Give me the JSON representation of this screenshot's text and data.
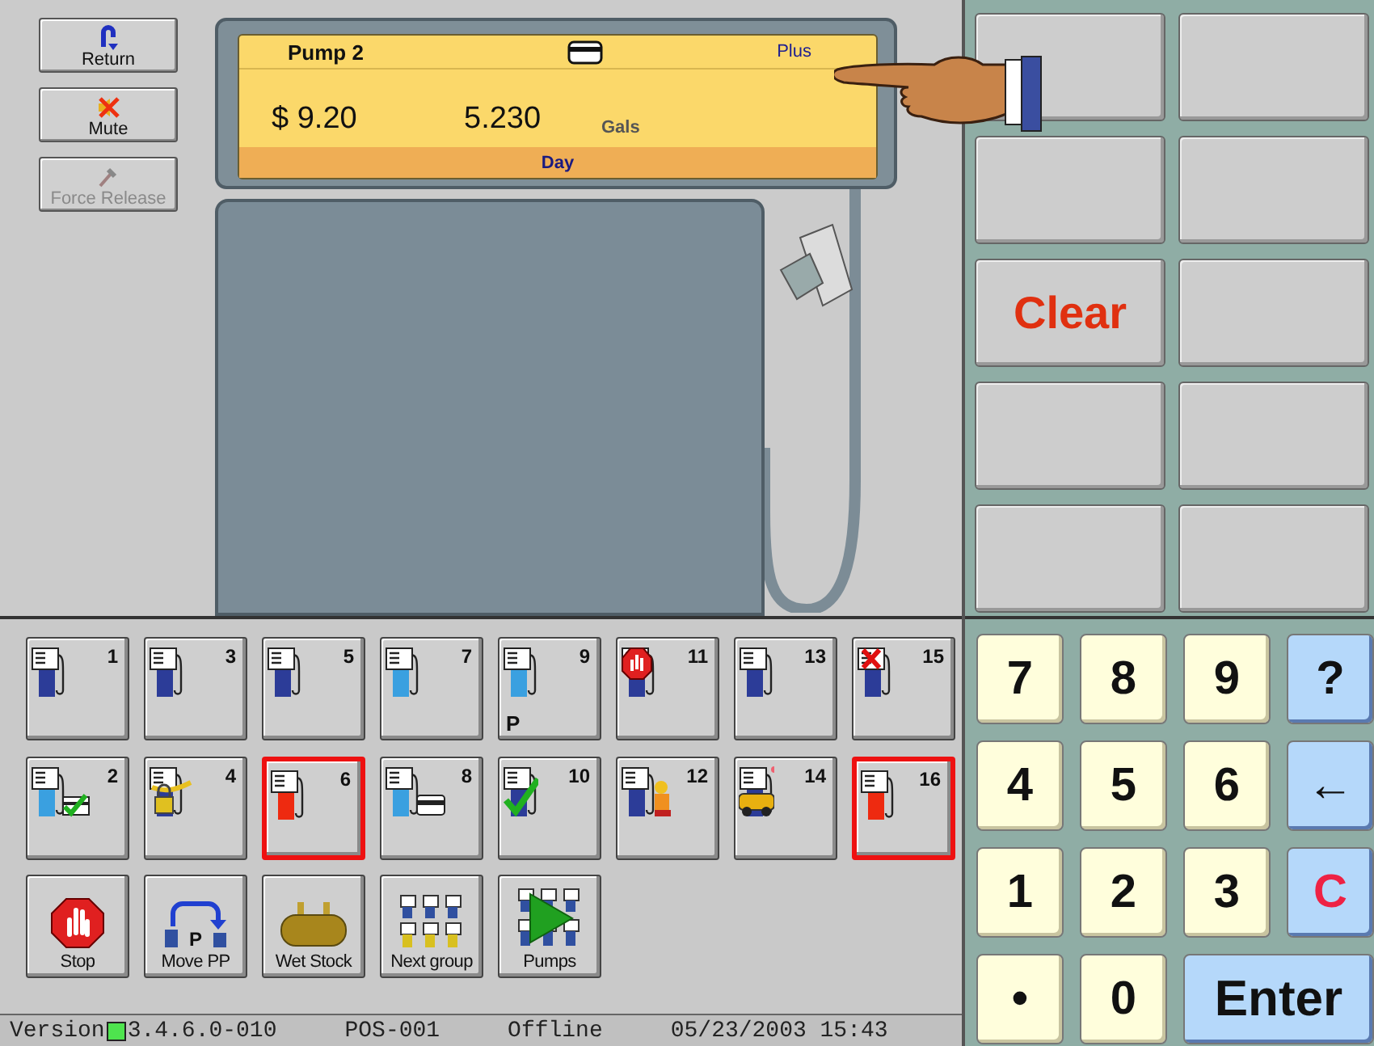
{
  "side_buttons": [
    {
      "label": "Return",
      "kind": "return",
      "disabled": false
    },
    {
      "label": "Mute",
      "kind": "mute",
      "disabled": false
    },
    {
      "label": "Force Release",
      "kind": "release",
      "disabled": true
    }
  ],
  "display": {
    "pump": "Pump 2",
    "grade": "Plus",
    "amount": "$ 9.20",
    "volume": "5.230",
    "unit": "Gals",
    "mode": "Day"
  },
  "function_keys": [
    {
      "kind": "blank"
    },
    {
      "kind": "blank"
    },
    {
      "kind": "blank"
    },
    {
      "kind": "blank"
    },
    {
      "kind": "label",
      "label": "Clear"
    },
    {
      "kind": "blank"
    },
    {
      "kind": "blank"
    },
    {
      "kind": "blank"
    },
    {
      "kind": "blank"
    },
    {
      "kind": "blank"
    }
  ],
  "pumps": [
    {
      "number": "1",
      "kind": "idle",
      "alert": false
    },
    {
      "number": "3",
      "kind": "idle",
      "alert": false
    },
    {
      "number": "5",
      "kind": "idle",
      "alert": false
    },
    {
      "number": "7",
      "kind": "calling",
      "alert": false
    },
    {
      "number": "9",
      "kind": "prepay",
      "mark": "P",
      "alert": false
    },
    {
      "number": "11",
      "kind": "stopped",
      "alert": false
    },
    {
      "number": "13",
      "kind": "idle",
      "alert": false
    },
    {
      "number": "15",
      "kind": "error",
      "alert": false
    },
    {
      "number": "2",
      "kind": "paid",
      "alert": false
    },
    {
      "number": "4",
      "kind": "locked",
      "alert": false
    },
    {
      "number": "6",
      "kind": "offline",
      "alert": true
    },
    {
      "number": "8",
      "kind": "card",
      "alert": false
    },
    {
      "number": "10",
      "kind": "done",
      "alert": false
    },
    {
      "number": "12",
      "kind": "service",
      "alert": false
    },
    {
      "number": "14",
      "kind": "accident",
      "alert": false
    },
    {
      "number": "16",
      "kind": "offline",
      "alert": true
    }
  ],
  "actions": [
    {
      "label": "Stop",
      "kind": "stop"
    },
    {
      "label": "Move PP",
      "kind": "move",
      "mark": "P"
    },
    {
      "label": "Wet Stock",
      "kind": "tank"
    },
    {
      "label": "Next group",
      "kind": "group"
    },
    {
      "label": "Pumps",
      "kind": "pumps"
    }
  ],
  "keypad": [
    {
      "label": "7",
      "kind": "digit"
    },
    {
      "label": "8",
      "kind": "digit"
    },
    {
      "label": "9",
      "kind": "digit"
    },
    {
      "label": "?",
      "kind": "func"
    },
    {
      "label": "4",
      "kind": "digit"
    },
    {
      "label": "5",
      "kind": "digit"
    },
    {
      "label": "6",
      "kind": "digit"
    },
    {
      "label": "←",
      "kind": "func"
    },
    {
      "label": "1",
      "kind": "digit"
    },
    {
      "label": "2",
      "kind": "digit"
    },
    {
      "label": "3",
      "kind": "digit"
    },
    {
      "label": "C",
      "kind": "clear"
    },
    {
      "label": "•",
      "kind": "digit"
    },
    {
      "label": "0",
      "kind": "digit"
    },
    {
      "label": "Enter",
      "kind": "enter"
    }
  ],
  "status_bar": {
    "version_label": "Version",
    "version": "3.4.6.0-010",
    "terminal": "POS-001",
    "connection": "Offline",
    "datetime": "05/23/2003 15:43"
  }
}
